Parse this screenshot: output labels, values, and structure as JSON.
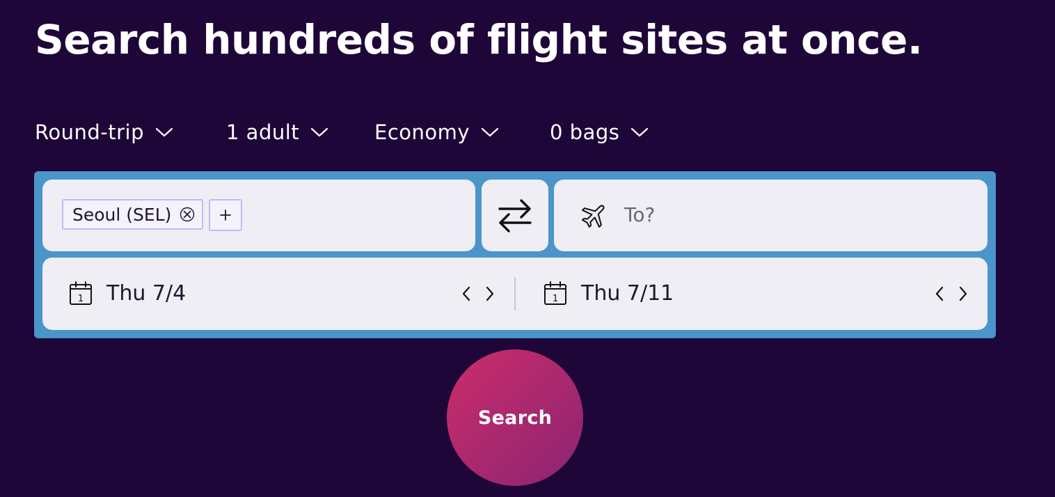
{
  "headline": "Search hundreds of flight sites at once.",
  "options": {
    "trip_type": "Round-trip",
    "travelers": "1 adult",
    "cabin": "Economy",
    "bags": "0 bags"
  },
  "origin": {
    "chip_label": "Seoul (SEL)",
    "remove_icon": "close-icon",
    "add_icon": "plus-icon"
  },
  "swap": {
    "icon": "swap-arrows-icon"
  },
  "destination": {
    "placeholder": "To?",
    "icon": "plane-icon"
  },
  "dates": {
    "depart": "Thu 7/4",
    "return": "Thu 7/11",
    "calendar_day": "1"
  },
  "search_button": "Search",
  "colors": {
    "background": "#1f0638",
    "searchbox_border": "#4a95c9",
    "field_bg": "#efeef4",
    "chip_border": "#c9b6f4",
    "button_gradient_start": "#cc2d6b",
    "button_gradient_end": "#8a2472"
  }
}
